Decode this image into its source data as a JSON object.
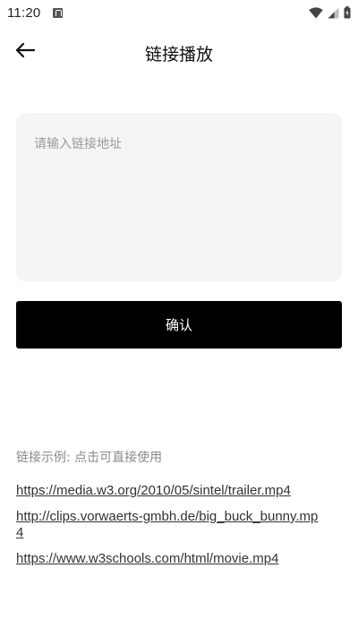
{
  "status_bar": {
    "time": "11:20",
    "icons": [
      "app-notification-icon",
      "wifi-icon",
      "cellular-signal-icon",
      "battery-icon"
    ]
  },
  "header": {
    "back_icon": "arrow-left-icon",
    "title": "链接播放"
  },
  "input": {
    "placeholder": "请输入链接地址",
    "value": ""
  },
  "confirm": {
    "label": "确认"
  },
  "examples": {
    "heading": "链接示例: 点击可直接使用",
    "links": [
      "https://media.w3.org/2010/05/sintel/trailer.mp4",
      "http://clips.vorwaerts-gmbh.de/big_buck_bunny.mp4",
      "https://www.w3schools.com/html/movie.mp4"
    ]
  },
  "colors": {
    "background": "#ffffff",
    "input_background": "#f5f5f5",
    "button_background": "#000000",
    "button_text": "#ffffff",
    "muted_text": "#8a8a8a"
  }
}
